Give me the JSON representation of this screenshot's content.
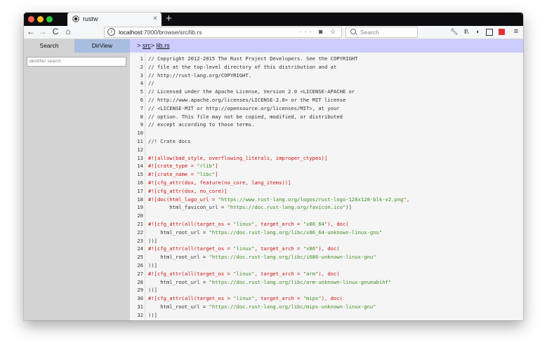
{
  "browser": {
    "tab_title": "rustw",
    "tab_close": "×",
    "new_tab": "+",
    "nav": {
      "back": "←",
      "forward": "→",
      "reload": "C",
      "home": "⌂"
    },
    "url_host": "localhost",
    "url_rest": ":7000/browse/src/lib.rs",
    "url_icons": "··· ◙ ☆",
    "search_placeholder": "Search",
    "toolbar_icons": [
      "wrench-icon",
      "library-icon",
      "paint-icon",
      "sidebar-icon",
      "extension-icon",
      "menu-icon"
    ]
  },
  "sidebar": {
    "tabs": [
      "Search",
      "DirView"
    ],
    "identifier_search_placeholder": "identifier search"
  },
  "breadcrumb": {
    "arrow": ">",
    "dir": "src",
    "sep": ">",
    "file": "lib.rs"
  },
  "code": {
    "lines": [
      {
        "n": "1",
        "parts": [
          {
            "t": "// Copyright 2012-2015 The Rust Project Developers. See the COPYRIGHT",
            "c": "plain"
          }
        ]
      },
      {
        "n": "2",
        "parts": [
          {
            "t": "// file at the top-level directory of this distribution and at",
            "c": "plain"
          }
        ]
      },
      {
        "n": "3",
        "parts": [
          {
            "t": "// http://rust-lang.org/COPYRIGHT.",
            "c": "plain"
          }
        ]
      },
      {
        "n": "4",
        "parts": [
          {
            "t": "//",
            "c": "plain"
          }
        ]
      },
      {
        "n": "5",
        "parts": [
          {
            "t": "// Licensed under the Apache License, Version 2.0 <LICENSE-APACHE or",
            "c": "plain"
          }
        ]
      },
      {
        "n": "6",
        "parts": [
          {
            "t": "// http://www.apache.org/licenses/LICENSE-2.0> or the MIT license",
            "c": "plain"
          }
        ]
      },
      {
        "n": "7",
        "parts": [
          {
            "t": "// <LICENSE-MIT or http://opensource.org/licenses/MIT>, at your",
            "c": "plain"
          }
        ]
      },
      {
        "n": "8",
        "parts": [
          {
            "t": "// option. This file may not be copied, modified, or distributed",
            "c": "plain"
          }
        ]
      },
      {
        "n": "9",
        "parts": [
          {
            "t": "// except according to those terms.",
            "c": "plain"
          }
        ]
      },
      {
        "n": "10",
        "parts": []
      },
      {
        "n": "11",
        "parts": [
          {
            "t": "//! Crate docs",
            "c": "plain"
          }
        ]
      },
      {
        "n": "12",
        "parts": []
      },
      {
        "n": "13",
        "parts": [
          {
            "t": "#![allow(bad_style, overflowing_literals, improper_ctypes)]",
            "c": "attr"
          }
        ]
      },
      {
        "n": "14",
        "parts": [
          {
            "t": "#![crate_type = ",
            "c": "attr"
          },
          {
            "t": "\"rlib\"",
            "c": "str"
          },
          {
            "t": "]",
            "c": "attr"
          }
        ]
      },
      {
        "n": "15",
        "parts": [
          {
            "t": "#![crate_name = ",
            "c": "attr"
          },
          {
            "t": "\"libc\"",
            "c": "str"
          },
          {
            "t": "]",
            "c": "attr"
          }
        ]
      },
      {
        "n": "16",
        "parts": [
          {
            "t": "#![cfg_attr(dox, feature(no_core, lang_items))]",
            "c": "attr"
          }
        ]
      },
      {
        "n": "17",
        "parts": [
          {
            "t": "#![cfg_attr(dox, no_core)]",
            "c": "attr"
          }
        ]
      },
      {
        "n": "18",
        "parts": [
          {
            "t": "#![doc(html_logo_url = ",
            "c": "attr"
          },
          {
            "t": "\"https://www.rust-lang.org/logos/rust-logo-128x128-blk-v2.png\"",
            "c": "str"
          },
          {
            "t": ",",
            "c": "attr"
          }
        ]
      },
      {
        "n": "19",
        "parts": [
          {
            "t": "       html_favicon_url = ",
            "c": "plain"
          },
          {
            "t": "\"https://doc.rust-lang.org/favicon.ico\"",
            "c": "str"
          },
          {
            "t": ")]",
            "c": "plain"
          }
        ]
      },
      {
        "n": "20",
        "parts": []
      },
      {
        "n": "21",
        "parts": [
          {
            "t": "#![cfg_attr(all(target_os = ",
            "c": "attr"
          },
          {
            "t": "\"linux\"",
            "c": "str"
          },
          {
            "t": ", target_arch = ",
            "c": "attr"
          },
          {
            "t": "\"x86_64\"",
            "c": "str"
          },
          {
            "t": "), doc(",
            "c": "attr"
          }
        ]
      },
      {
        "n": "22",
        "parts": [
          {
            "t": "    html_root_url = ",
            "c": "plain"
          },
          {
            "t": "\"https://doc.rust-lang.org/libc/x86_64-unknown-linux-gnu\"",
            "c": "str"
          }
        ]
      },
      {
        "n": "23",
        "parts": [
          {
            "t": "))]",
            "c": "plain"
          }
        ]
      },
      {
        "n": "24",
        "parts": [
          {
            "t": "#![cfg_attr(all(target_os = ",
            "c": "attr"
          },
          {
            "t": "\"linux\"",
            "c": "str"
          },
          {
            "t": ", target_arch = ",
            "c": "attr"
          },
          {
            "t": "\"x86\"",
            "c": "str"
          },
          {
            "t": "), doc(",
            "c": "attr"
          }
        ]
      },
      {
        "n": "25",
        "parts": [
          {
            "t": "    html_root_url = ",
            "c": "plain"
          },
          {
            "t": "\"https://doc.rust-lang.org/libc/i686-unknown-linux-gnu\"",
            "c": "str"
          }
        ]
      },
      {
        "n": "26",
        "parts": [
          {
            "t": "))]",
            "c": "plain"
          }
        ]
      },
      {
        "n": "27",
        "parts": [
          {
            "t": "#![cfg_attr(all(target_os = ",
            "c": "attr"
          },
          {
            "t": "\"linux\"",
            "c": "str"
          },
          {
            "t": ", target_arch = ",
            "c": "attr"
          },
          {
            "t": "\"arm\"",
            "c": "str"
          },
          {
            "t": "), doc(",
            "c": "attr"
          }
        ]
      },
      {
        "n": "28",
        "parts": [
          {
            "t": "    html_root_url = ",
            "c": "plain"
          },
          {
            "t": "\"https://doc.rust-lang.org/libc/arm-unknown-linux-gnueabihf\"",
            "c": "str"
          }
        ]
      },
      {
        "n": "29",
        "parts": [
          {
            "t": "))]",
            "c": "plain"
          }
        ]
      },
      {
        "n": "30",
        "parts": [
          {
            "t": "#![cfg_attr(all(target_os = ",
            "c": "attr"
          },
          {
            "t": "\"linux\"",
            "c": "str"
          },
          {
            "t": ", target_arch = ",
            "c": "attr"
          },
          {
            "t": "\"mips\"",
            "c": "str"
          },
          {
            "t": "), doc(",
            "c": "attr"
          }
        ]
      },
      {
        "n": "31",
        "parts": [
          {
            "t": "    html_root_url = ",
            "c": "plain"
          },
          {
            "t": "\"https://doc.rust-lang.org/libc/mips-unknown-linux-gnu\"",
            "c": "str"
          }
        ]
      },
      {
        "n": "32",
        "parts": [
          {
            "t": "))]",
            "c": "plain"
          }
        ]
      }
    ]
  },
  "colors": {
    "attr": "#cc1111",
    "string": "#448c27",
    "breadcrumb_bg": "#ccccff",
    "dirview_tab": "#a8bddf"
  }
}
